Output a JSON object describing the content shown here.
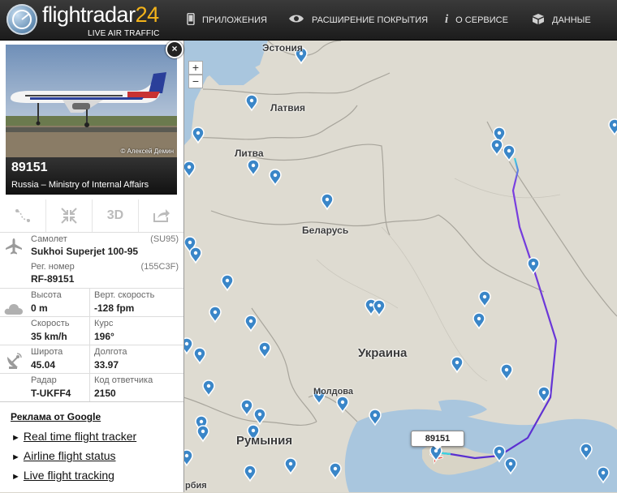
{
  "header": {
    "logo_name": "flightradar",
    "logo_number": "24",
    "logo_tagline": "LIVE AIR TRAFFIC",
    "nav": [
      {
        "label": "ПРИЛОЖЕНИЯ",
        "icon": "phone-icon"
      },
      {
        "label": "РАСШИРЕНИЕ ПОКРЫТИЯ",
        "icon": "eye-icon"
      },
      {
        "label": "О СЕРВИСЕ",
        "icon": "info-icon"
      },
      {
        "label": "ДАННЫЕ",
        "icon": "box-icon"
      }
    ]
  },
  "map": {
    "zoom_in": "+",
    "zoom_out": "−",
    "countries": [
      "Эстония",
      "Латвия",
      "Литва",
      "Беларусь",
      "Украина",
      "Молдова",
      "Румыния",
      "рбия"
    ],
    "flight_label": "89151",
    "route_colors": {
      "start": "#3ad5e0",
      "mid": "#7b3fe0",
      "end": "#5a2fd0"
    }
  },
  "panel": {
    "close": "×",
    "photo_credit": "© Алексей Демин",
    "callsign": "89151",
    "airline": "Russia – Ministry of Internal Affairs",
    "tools": {
      "route": "route-icon",
      "collapse": "collapse-icon",
      "threed": "3D",
      "share": "share-icon"
    },
    "aircraft_label": "Самолет",
    "aircraft_code": "(SU95)",
    "aircraft_value": "Sukhoi Superjet 100-95",
    "reg_label": "Рег. номер",
    "reg_code": "(155C3F)",
    "reg_value": "RF-89151",
    "altitude_label": "Высота",
    "altitude_value": "0 m",
    "vspeed_label": "Верт. скорость",
    "vspeed_value": "-128 fpm",
    "speed_label": "Скорость",
    "speed_value": "35 km/h",
    "course_label": "Курс",
    "course_value": "196°",
    "lat_label": "Широта",
    "lat_value": "45.04",
    "lon_label": "Долгота",
    "lon_value": "33.97",
    "radar_label": "Радар",
    "radar_value": "T-UKFF4",
    "squawk_label": "Код ответчика",
    "squawk_value": "2150"
  },
  "ads": {
    "title": "Реклама от Google",
    "arrow": "►",
    "links": [
      "Real time flight tracker",
      "Airline flight status",
      "Live flight tracking"
    ]
  }
}
